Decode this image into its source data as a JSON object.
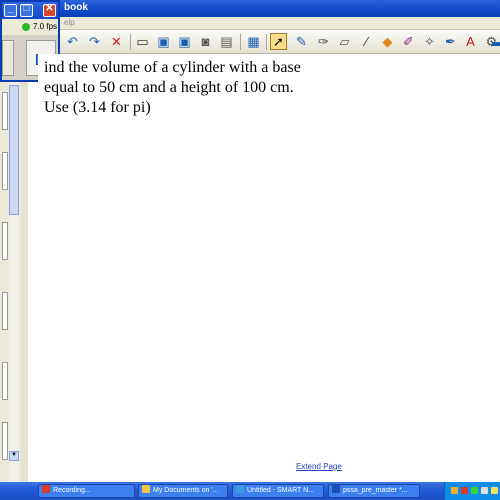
{
  "window": {
    "title": "book",
    "menu_hint": "elp"
  },
  "recorder": {
    "fps": "7.0 fps"
  },
  "toolbar": {
    "buttons": [
      {
        "name": "undo-icon",
        "glyph": "↶",
        "color": "#2a5db0"
      },
      {
        "name": "redo-icon",
        "glyph": "↷",
        "color": "#2a5db0"
      },
      {
        "name": "delete-icon",
        "glyph": "✕",
        "color": "#d02020"
      },
      {
        "name": "screen-shade-icon",
        "glyph": "▭",
        "color": "#333"
      },
      {
        "name": "monitor-icon",
        "glyph": "▣",
        "color": "#1a5fb4"
      },
      {
        "name": "display-icon",
        "glyph": "▣",
        "color": "#1a5fb4"
      },
      {
        "name": "capture-icon",
        "glyph": "◙",
        "color": "#555"
      },
      {
        "name": "insert-icon",
        "glyph": "▤",
        "color": "#555"
      },
      {
        "name": "table-icon",
        "glyph": "▦",
        "color": "#1a5fb4"
      },
      {
        "name": "select-arrow-icon",
        "glyph": "➚",
        "color": "#111"
      },
      {
        "name": "pen-icon",
        "glyph": "✎",
        "color": "#2a5db0"
      },
      {
        "name": "creative-pen-icon",
        "glyph": "✑",
        "color": "#444"
      },
      {
        "name": "eraser-icon",
        "glyph": "▱",
        "color": "#555"
      },
      {
        "name": "line-icon",
        "glyph": "∕",
        "color": "#333"
      },
      {
        "name": "shape-icon",
        "glyph": "◆",
        "color": "#e08a20"
      },
      {
        "name": "fill-icon",
        "glyph": "✐",
        "color": "#8a2a8a"
      },
      {
        "name": "magic-pen-icon",
        "glyph": "✧",
        "color": "#444"
      },
      {
        "name": "highlighter-icon",
        "glyph": "✒",
        "color": "#2a5db0"
      },
      {
        "name": "text-icon",
        "glyph": "A",
        "color": "#c01818"
      },
      {
        "name": "properties-icon",
        "glyph": "⚙",
        "color": "#555"
      },
      {
        "name": "gallery-icon",
        "glyph": "▬",
        "color": "#1a5fb4"
      }
    ]
  },
  "canvas": {
    "lines": [
      "ind the volume of a cylinder with a base",
      "equal to 50 cm and a height of 100 cm.",
      "Use (3.14 for pi)"
    ],
    "extend_page": "Extend Page"
  },
  "taskbar": {
    "items": [
      {
        "label": "Recording...",
        "icon_color": "#d83a2a"
      },
      {
        "label": "My Documents on '...",
        "icon_color": "#f2c54a"
      },
      {
        "label": "Untitled - SMART N...",
        "icon_color": "#3a9ae0"
      },
      {
        "label": "pssa_pre_master *...",
        "icon_color": "#1d4fb0"
      }
    ]
  }
}
